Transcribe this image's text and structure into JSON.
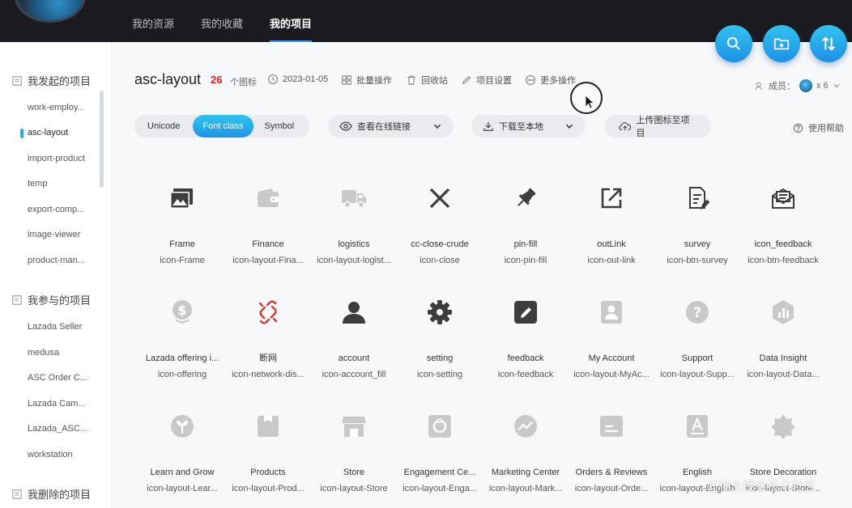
{
  "nav": {
    "items": [
      {
        "label": "我的资源"
      },
      {
        "label": "我的收藏"
      },
      {
        "label": "我的项目"
      }
    ]
  },
  "sidebar": {
    "groups": [
      {
        "title": "我发起的项目",
        "items": [
          "work-employ...",
          "asc-layout",
          "import-product",
          "temp",
          "export-comp...",
          "image-viewer",
          "product-man..."
        ]
      },
      {
        "title": "我参与的项目",
        "items": [
          "Lazada Seller",
          "medusa",
          "ASC Order C...",
          "Lazada Cam...",
          "Lazada_ASC...",
          "workstation"
        ]
      },
      {
        "title": "我删除的项目",
        "items": []
      }
    ],
    "active_item": "asc-layout"
  },
  "project": {
    "title": "asc-layout",
    "count": "26",
    "count_unit": "个图标",
    "date": "2023-01-05",
    "batch": "批量操作",
    "recycle": "回收站",
    "settings": "项目设置",
    "more": "更多操作",
    "members_label": "成员：",
    "members_count": "x 6"
  },
  "toolbar": {
    "tabs": [
      {
        "label": "Unicode"
      },
      {
        "label": "Font class"
      },
      {
        "label": "Symbol"
      }
    ],
    "view_link": "查看在线链接",
    "download": "下载至本地",
    "upload": "上传图标至项目",
    "help": "使用帮助"
  },
  "icons": [
    {
      "name": "Frame",
      "cls": "icon-Frame",
      "icon": "image-icon"
    },
    {
      "name": "Finance",
      "cls": "icon-layout-Fina...",
      "icon": "wallet-icon"
    },
    {
      "name": "logistics",
      "cls": "icon-layout-logist...",
      "icon": "truck-icon"
    },
    {
      "name": "cc-close-crude",
      "cls": "icon-close",
      "icon": "close-icon"
    },
    {
      "name": "pin-fill",
      "cls": "icon-pin-fill",
      "icon": "pin-icon"
    },
    {
      "name": "outLink",
      "cls": "icon-out-link",
      "icon": "external-link-icon"
    },
    {
      "name": "survey",
      "cls": "icon-btn-survey",
      "icon": "survey-icon"
    },
    {
      "name": "icon_feedback",
      "cls": "icon-btn-feedback",
      "icon": "envelope-icon"
    },
    {
      "name": "Lazada offering i...",
      "cls": "icon-offering",
      "icon": "dollar-icon"
    },
    {
      "name": "断网",
      "cls": "icon-network-dis...",
      "icon": "broken-link-icon"
    },
    {
      "name": "account",
      "cls": "icon-account_fill",
      "icon": "user-icon"
    },
    {
      "name": "setting",
      "cls": "icon-setting",
      "icon": "gear-icon"
    },
    {
      "name": "feedback",
      "cls": "icon-feedback",
      "icon": "edit-icon"
    },
    {
      "name": "My Account",
      "cls": "icon-layout-MyAc...",
      "icon": "account-card-icon"
    },
    {
      "name": "Support",
      "cls": "icon-layout-Supp...",
      "icon": "question-icon"
    },
    {
      "name": "Data Insight",
      "cls": "icon-layout-Data...",
      "icon": "chart-icon"
    },
    {
      "name": "Learn and Grow",
      "cls": "icon-layout-Lear...",
      "icon": "sprout-icon"
    },
    {
      "name": "Products",
      "cls": "icon-layout-Prod...",
      "icon": "box-icon"
    },
    {
      "name": "Store",
      "cls": "icon-layout-Store",
      "icon": "store-icon"
    },
    {
      "name": "Engagement Ce...",
      "cls": "icon-layout-Enga...",
      "icon": "engagement-icon"
    },
    {
      "name": "Marketing Center",
      "cls": "icon-layout-Mark...",
      "icon": "trend-icon"
    },
    {
      "name": "Orders & Reviews",
      "cls": "icon-layout-Orde...",
      "icon": "orders-icon"
    },
    {
      "name": "English",
      "cls": "icon-layout-English",
      "icon": "letter-a-icon"
    },
    {
      "name": "Store Decoration",
      "cls": "icon-layout-Store...",
      "icon": "badge-icon"
    }
  ],
  "watermark": "@稀土掘金技术社区"
}
